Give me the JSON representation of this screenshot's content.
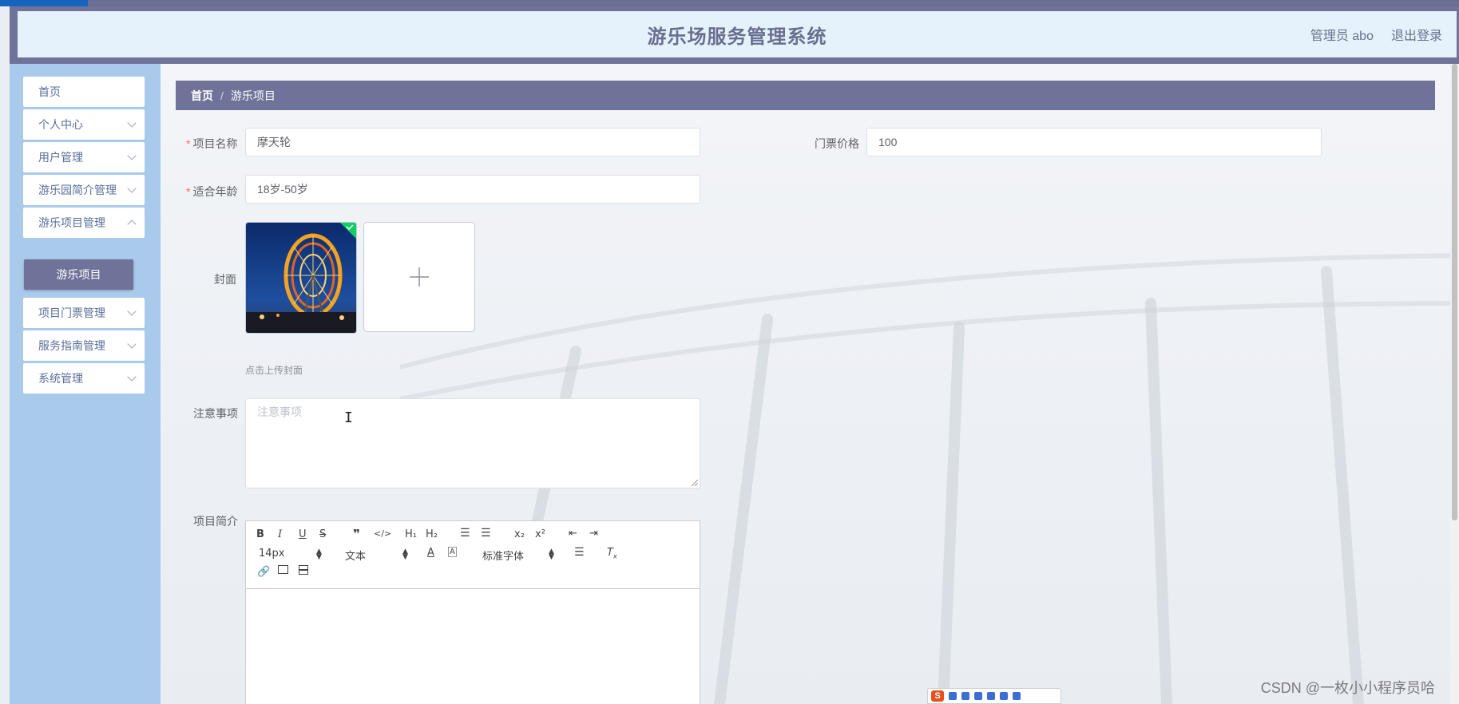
{
  "header": {
    "title": "游乐场服务管理系统",
    "user": "管理员 abo",
    "logout": "退出登录"
  },
  "sidebar": {
    "items": [
      {
        "label": "首页",
        "expandable": false
      },
      {
        "label": "个人中心",
        "expandable": true
      },
      {
        "label": "用户管理",
        "expandable": true
      },
      {
        "label": "游乐园简介管理",
        "expandable": true
      },
      {
        "label": "游乐项目管理",
        "expandable": true
      },
      {
        "label": "项目门票管理",
        "expandable": true
      },
      {
        "label": "服务指南管理",
        "expandable": true
      },
      {
        "label": "系统管理",
        "expandable": true
      }
    ],
    "active_sub": "游乐项目"
  },
  "breadcrumb": {
    "home": "首页",
    "separator": "/",
    "current": "游乐项目"
  },
  "form": {
    "name_label": "项目名称",
    "name_value": "摩天轮",
    "price_label": "门票价格",
    "price_value": "100",
    "age_label": "适合年龄",
    "age_value": "18岁-50岁",
    "cover_label": "封面",
    "cover_hint": "点击上传封面",
    "notice_label": "注意事项",
    "notice_placeholder": "注意事项",
    "intro_label": "项目简介",
    "required_mark": "*"
  },
  "editor": {
    "font_size": "14px",
    "header_select": "文本",
    "font_family": "标准字体",
    "buttons": {
      "h1": "H₁",
      "h2": "H₂",
      "sub": "x₂",
      "sup": "x²"
    }
  },
  "watermark": "CSDN @一枚小小程序员哈",
  "ime": {
    "label": "S"
  },
  "colors": {
    "header_bg": "#e6f2fb",
    "title": "#6a6f8f",
    "sidebar_bg": "#aacaec",
    "accent": "#6f7399",
    "required": "#f56c6c"
  }
}
